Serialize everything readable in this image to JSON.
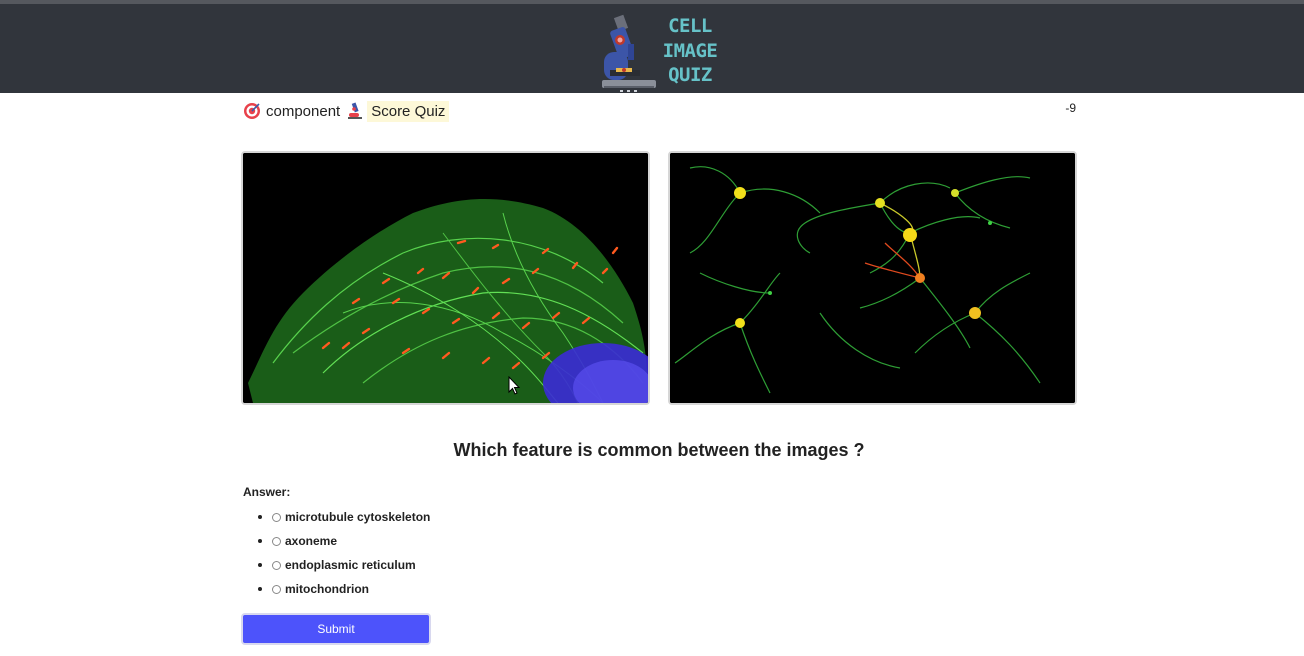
{
  "header": {
    "logo_lines": [
      "CELL",
      "IMAGE",
      "QUIZ"
    ],
    "logo_icon": "microscope-icon"
  },
  "nav": {
    "component_icon": "target-icon",
    "component_label": "component",
    "score_icon": "microscope-icon",
    "score_label": "Score Quiz",
    "score_value": "-9"
  },
  "images": [
    {
      "name": "cell-image-fibroblast",
      "description_icon": "fluorescent-cell-image"
    },
    {
      "name": "cell-image-neurons",
      "description_icon": "fluorescent-neuron-image"
    }
  ],
  "quiz": {
    "question": "Which feature is common between the images ?",
    "answer_label": "Answer:",
    "options": [
      "microtubule cytoskeleton",
      "axoneme",
      "endoplasmic reticulum",
      "mitochondrion"
    ],
    "submit_label": "Submit"
  },
  "colors": {
    "header_bg": "#31353c",
    "logo_text": "#66c2c8",
    "submit_bg": "#4d53fb",
    "score_highlight": "#fdf8d8"
  }
}
